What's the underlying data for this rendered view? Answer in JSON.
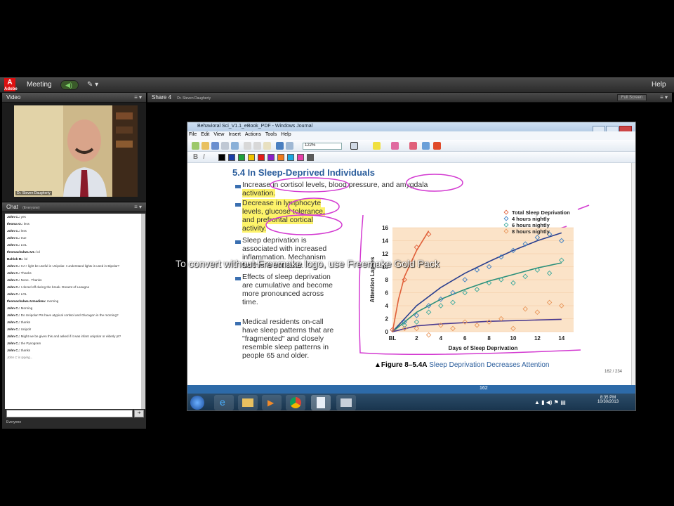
{
  "appbar": {
    "logo": "Adobe",
    "menu_meeting": "Meeting",
    "help": "Help"
  },
  "video_pod": {
    "title": "Video",
    "presenter_name": "Dr. Steven Daugherty"
  },
  "chat_pod": {
    "title": "Chat",
    "scope": "(Everyone)",
    "messages": [
      {
        "who": "John C.:",
        "text": "yes"
      },
      {
        "who": "Ifeoma O.:",
        "text": "less"
      },
      {
        "who": "John C.:",
        "text": "less"
      },
      {
        "who": "John C.:",
        "text": "true"
      },
      {
        "who": "John C.:",
        "text": "LOL"
      },
      {
        "who": "Ifeomachukwu Ut.:",
        "text": "lol"
      },
      {
        "who": "Bahlok M.:",
        "text": "lol"
      },
      {
        "who": "John C.:",
        "text": "CA+ light be useful in Unipolar. I understand lightx is used in Bipolar?"
      },
      {
        "who": "John C.:",
        "text": "Thanks"
      },
      {
        "who": "John C.:",
        "text": "None . Thanks"
      },
      {
        "who": "John C.:",
        "text": "I dozed off during the break. Dreamt of Lasagne"
      },
      {
        "who": "John C.:",
        "text": "LOL"
      },
      {
        "who": "Ifeomachukwu Umadima:",
        "text": "morning"
      },
      {
        "who": "John C.:",
        "text": "Morning"
      },
      {
        "who": "John C.:",
        "text": "Do Unipolar Pts have atypical cortisol and Glucagon in the morning?"
      },
      {
        "who": "John C.:",
        "text": "thanks"
      },
      {
        "who": "John C.:",
        "text": "Unipolr"
      },
      {
        "who": "John C.:",
        "text": "Might we be given this and asked if it was infant unipolar or elderly pt?"
      },
      {
        "who": "John C.:",
        "text": "the Pynogram"
      },
      {
        "who": "John C.:",
        "text": "thanks"
      }
    ],
    "typing": "John C is typing...",
    "footer": "Everyone"
  },
  "share_pod": {
    "title": "Share 4",
    "presenter": "Dr. Steven Daugherty",
    "fullscreen": "Full Screen"
  },
  "journal": {
    "title": "Behavioral Sci_V1.1_eBook_PDF - Windows Journal",
    "menu": [
      "File",
      "Edit",
      "View",
      "Insert",
      "Actions",
      "Tools",
      "Help"
    ],
    "zoom": "122%",
    "pen_colors": [
      "#000000",
      "#1a3ea8",
      "#1ea13c",
      "#f0c400",
      "#e31b1b",
      "#8a1fc7",
      "#f07a1a",
      "#1aa6e0",
      "#e63ea8",
      "#5b5b5b"
    ]
  },
  "page": {
    "heading": "5.4  In Sleep-Deprived Individuals",
    "bullets": [
      [
        "Increase in cortisol levels, blood pressure, and amygdala",
        "activation."
      ],
      [
        "Decrease in lymphocyte",
        "levels, glucose tolerance,",
        "and prefrontal cortical",
        "activity."
      ],
      [
        "Sleep deprivation is",
        "associated with increased",
        "inflammation. Mechanism",
        "for this is not clear."
      ],
      [
        "Effects of sleep deprivation",
        "are cumulative and become",
        "more pronounced across",
        "time."
      ],
      [
        "Medical residents on-call",
        "have sleep patterns that are",
        "\"fragmented\" and closely",
        "resemble sleep patterns in",
        "people 65 and older."
      ]
    ],
    "caption_fig": "▲Figure  8–5.4A",
    "caption_text": "Sleep Deprivation Decreases Attention",
    "page_counter": "162 / 234",
    "status_page": "162"
  },
  "chart_data": {
    "type": "scatter",
    "xlabel": "Days of Sleep Deprivation",
    "ylabel": "Attention Lapses",
    "x_ticks": [
      "BL",
      "2",
      "4",
      "6",
      "8",
      "10",
      "12",
      "14"
    ],
    "y_ticks": [
      "0",
      "2",
      "4",
      "6",
      "8",
      "10",
      "12",
      "14",
      "16"
    ],
    "xlim": [
      0,
      15
    ],
    "ylim": [
      0,
      16
    ],
    "series": [
      {
        "name": "Total Sleep Deprivation",
        "color": "#e0603a",
        "points": [
          [
            0,
            0.3
          ],
          [
            1,
            8
          ],
          [
            2,
            13
          ],
          [
            3,
            15
          ]
        ]
      },
      {
        "name": "4 hours nightly",
        "color": "#3b7fc4",
        "points": [
          [
            1,
            1.5
          ],
          [
            2,
            2.5
          ],
          [
            3,
            4
          ],
          [
            4,
            5
          ],
          [
            5,
            6
          ],
          [
            6,
            8
          ],
          [
            7,
            9.5
          ],
          [
            8,
            10
          ],
          [
            9,
            11.5
          ],
          [
            10,
            12.5
          ],
          [
            11,
            13.5
          ],
          [
            12,
            14.5
          ],
          [
            13,
            15
          ],
          [
            14,
            14
          ]
        ]
      },
      {
        "name": "6 hours nightly",
        "color": "#3aa89c",
        "points": [
          [
            1,
            1
          ],
          [
            2,
            1.5
          ],
          [
            3,
            3
          ],
          [
            4,
            4
          ],
          [
            5,
            4.5
          ],
          [
            6,
            6
          ],
          [
            7,
            6.5
          ],
          [
            8,
            7.5
          ],
          [
            9,
            8
          ],
          [
            10,
            7.5
          ],
          [
            11,
            8.5
          ],
          [
            12,
            9.5
          ],
          [
            13,
            9
          ],
          [
            14,
            11
          ]
        ]
      },
      {
        "name": "8 hours nightly",
        "color": "#e8965a",
        "points": [
          [
            1,
            0.5
          ],
          [
            2,
            0.5
          ],
          [
            3,
            -0.5
          ],
          [
            4,
            1
          ],
          [
            5,
            0.5
          ],
          [
            6,
            1.5
          ],
          [
            7,
            1
          ],
          [
            8,
            1.5
          ],
          [
            9,
            2
          ],
          [
            10,
            0.5
          ],
          [
            11,
            3.5
          ],
          [
            12,
            3
          ],
          [
            13,
            4.5
          ],
          [
            14,
            4
          ]
        ]
      }
    ],
    "fit_curves": [
      {
        "color": "#e0603a",
        "points": [
          [
            0,
            0
          ],
          [
            0.5,
            5
          ],
          [
            1,
            8.5
          ],
          [
            2,
            12.5
          ],
          [
            3,
            15.5
          ]
        ]
      },
      {
        "color": "#2a3f8f",
        "points": [
          [
            0,
            0
          ],
          [
            2,
            4
          ],
          [
            4,
            6.8
          ],
          [
            6,
            9
          ],
          [
            8,
            10.8
          ],
          [
            10,
            12.5
          ],
          [
            12,
            14
          ],
          [
            14,
            15.2
          ]
        ]
      },
      {
        "color": "#2a8f7a",
        "points": [
          [
            0,
            0
          ],
          [
            2,
            3
          ],
          [
            4,
            5
          ],
          [
            6,
            6.5
          ],
          [
            8,
            7.8
          ],
          [
            10,
            8.8
          ],
          [
            12,
            9.8
          ],
          [
            14,
            10.6
          ]
        ]
      },
      {
        "color": "#4a3a8f",
        "points": [
          [
            0,
            0
          ],
          [
            2,
            0.9
          ],
          [
            4,
            1.2
          ],
          [
            6,
            1.4
          ],
          [
            8,
            1.6
          ],
          [
            10,
            1.7
          ],
          [
            12,
            1.8
          ],
          [
            14,
            1.9
          ]
        ]
      }
    ]
  },
  "taskbar": {
    "time": "8:35 PM",
    "date": "10/30/2013"
  },
  "watermark": "To convert without Freemake logo, use Freemake Gold Pack"
}
